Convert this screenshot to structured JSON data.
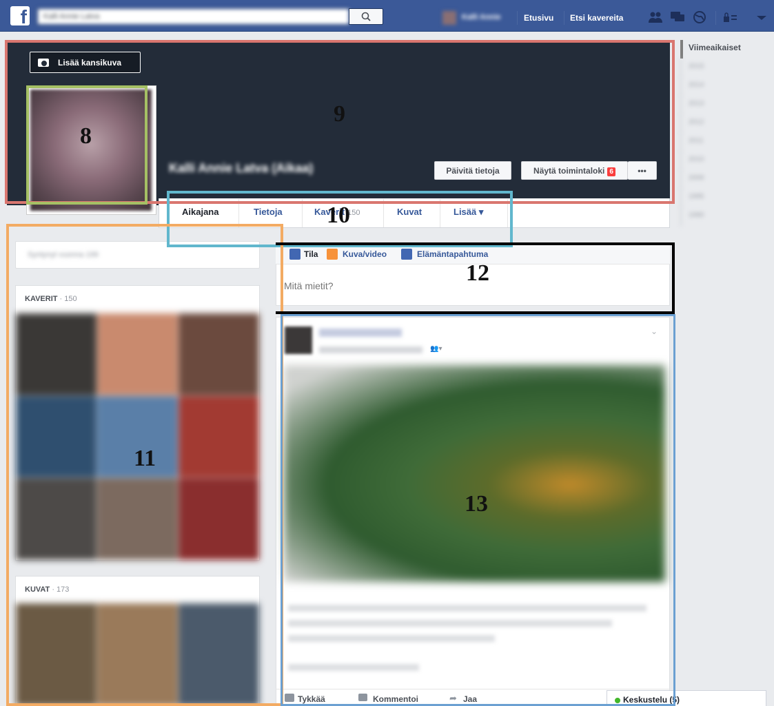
{
  "topbar": {
    "search_placeholder": "Kalli Annie Latva",
    "user_name": "Kalli Annie",
    "nav_home": "Etusivu",
    "nav_find_friends": "Etsi kavereita",
    "logo_letter": "f"
  },
  "cover": {
    "add_cover_label": "Lisää kansikuva",
    "profile_name": "Kalli Annie Latva (Aikaa)",
    "update_info_label": "Päivitä tietoja",
    "activity_log_label": "Näytä toimintaloki",
    "activity_log_badge": "6",
    "more_label": "•••"
  },
  "timeline_nav": {
    "tabs": [
      {
        "label": "Aikajana"
      },
      {
        "label": "Tietoja"
      },
      {
        "label": "Kaverit",
        "count": "150"
      },
      {
        "label": "Kuvat"
      },
      {
        "label": "Lisää ▾"
      }
    ]
  },
  "years": {
    "items": [
      "Viimeaikaiset",
      "2015",
      "2014",
      "2013",
      "2012",
      "2011",
      "2010",
      "2009",
      "1995",
      "1990"
    ]
  },
  "left": {
    "intro_text": "Syntynyt vuonna 199",
    "friends_header": "KAVERIT",
    "friends_count": " · 150",
    "photos_header": "KUVAT",
    "photos_count": " · 173"
  },
  "composer": {
    "tab_status": "Tila",
    "tab_photo": "Kuva/video",
    "tab_life_event": "Elämäntapahtuma",
    "placeholder": "Mitä mietit?"
  },
  "post": {
    "like": "Tykkää",
    "comment": "Kommentoi",
    "share": "Jaa"
  },
  "chat": {
    "label": "Keskustelu (5)"
  },
  "annotations": {
    "a8": "8",
    "a9": "9",
    "a10": "10",
    "a11": "11",
    "a12": "12",
    "a13": "13"
  },
  "colors": {
    "brand": "#3b5998",
    "cover_bg": "#232c39",
    "link": "#365899",
    "box_8": "#a5c064",
    "box_9": "#d9766f",
    "box_10": "#61b7cd",
    "box_11": "#f3ab63",
    "box_12": "#000000",
    "box_13": "#6ba0d2"
  }
}
